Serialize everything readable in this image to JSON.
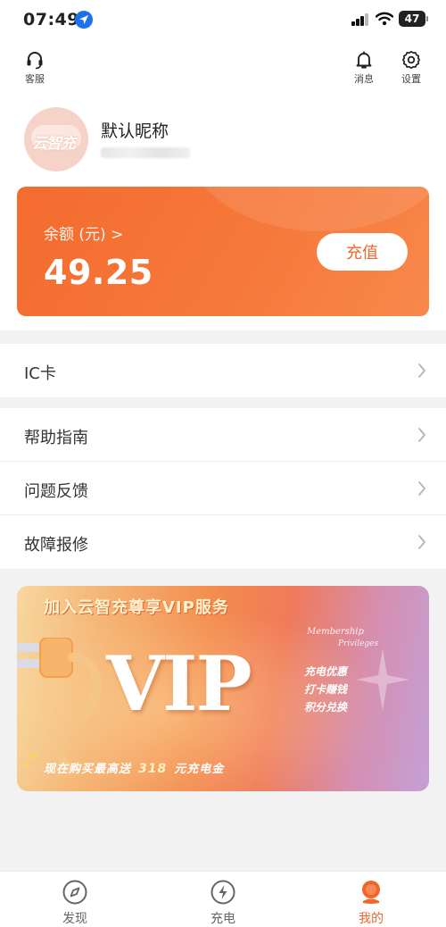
{
  "status_bar": {
    "time": "07:49",
    "battery": "47"
  },
  "header": {
    "support_label": "客服",
    "messages_label": "消息",
    "settings_label": "设置"
  },
  "profile": {
    "nickname": "默认昵称",
    "avatar_logo_text": "云智充"
  },
  "balance": {
    "label": "余额 (元) >",
    "value": "49.25",
    "recharge_label": "充值"
  },
  "menu_group_1": [
    {
      "label": "IC卡"
    }
  ],
  "menu_group_2": [
    {
      "label": "帮助指南"
    },
    {
      "label": "问题反馈"
    },
    {
      "label": "故障报修"
    }
  ],
  "vip_banner": {
    "title": "加入云智充尊享VIP服务",
    "big_text": "VIP",
    "membership": "Membership",
    "privileges": "Privileges",
    "perks": [
      "充电优惠",
      "打卡赚钱",
      "积分兑换"
    ],
    "footer_prefix": "现在购买最高送",
    "footer_amount": "318",
    "footer_suffix": "元充电金"
  },
  "tab_bar": {
    "tabs": [
      {
        "label": "发现",
        "icon": "compass-icon",
        "active": false
      },
      {
        "label": "充电",
        "icon": "bolt-icon",
        "active": false
      },
      {
        "label": "我的",
        "icon": "profile-icon",
        "active": true
      }
    ]
  },
  "colors": {
    "accent": "#f2662a",
    "card_start": "#f46b2f",
    "card_end": "#f8884c",
    "page_bg": "#f2f2f2"
  }
}
